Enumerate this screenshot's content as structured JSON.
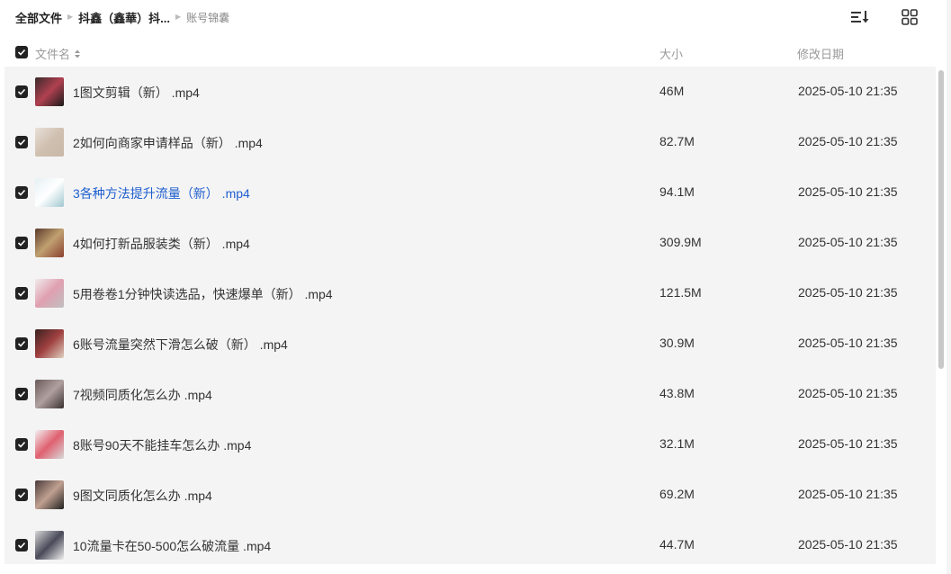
{
  "breadcrumb": {
    "root": "全部文件",
    "parent": "抖鑫（鑫華）抖...",
    "current": "账号锦囊"
  },
  "toolbar": {
    "sort_icon": "sort-list-icon",
    "grid_icon": "grid-view-icon"
  },
  "columns": {
    "name": "文件名",
    "size": "大小",
    "date": "修改日期"
  },
  "colors": {
    "link": "#1f5fcf",
    "row_bg": "#f4f4f4",
    "checkbox": "#222222"
  },
  "files": [
    {
      "name": "1图文剪辑（新） .mp4",
      "size": "46M",
      "date": "2025-05-10 21:35",
      "checked": true,
      "hover": false
    },
    {
      "name": "2如何向商家申请样品（新） .mp4",
      "size": "82.7M",
      "date": "2025-05-10 21:35",
      "checked": true,
      "hover": false
    },
    {
      "name": "3各种方法提升流量（新） .mp4",
      "size": "94.1M",
      "date": "2025-05-10 21:35",
      "checked": true,
      "hover": true
    },
    {
      "name": "4如何打新品服装类（新） .mp4",
      "size": "309.9M",
      "date": "2025-05-10 21:35",
      "checked": true,
      "hover": false
    },
    {
      "name": "5用卷卷1分钟快读选品，快速爆单（新） .mp4",
      "size": "121.5M",
      "date": "2025-05-10 21:35",
      "checked": true,
      "hover": false
    },
    {
      "name": "6账号流量突然下滑怎么破（新） .mp4",
      "size": "30.9M",
      "date": "2025-05-10 21:35",
      "checked": true,
      "hover": false
    },
    {
      "name": "7视频同质化怎么办 .mp4",
      "size": "43.8M",
      "date": "2025-05-10 21:35",
      "checked": true,
      "hover": false
    },
    {
      "name": "8账号90天不能挂车怎么办 .mp4",
      "size": "32.1M",
      "date": "2025-05-10 21:35",
      "checked": true,
      "hover": false
    },
    {
      "name": "9图文同质化怎么办 .mp4",
      "size": "69.2M",
      "date": "2025-05-10 21:35",
      "checked": true,
      "hover": false
    },
    {
      "name": "10流量卡在50-500怎么破流量 .mp4",
      "size": "44.7M",
      "date": "2025-05-10 21:35",
      "checked": true,
      "hover": false
    }
  ]
}
